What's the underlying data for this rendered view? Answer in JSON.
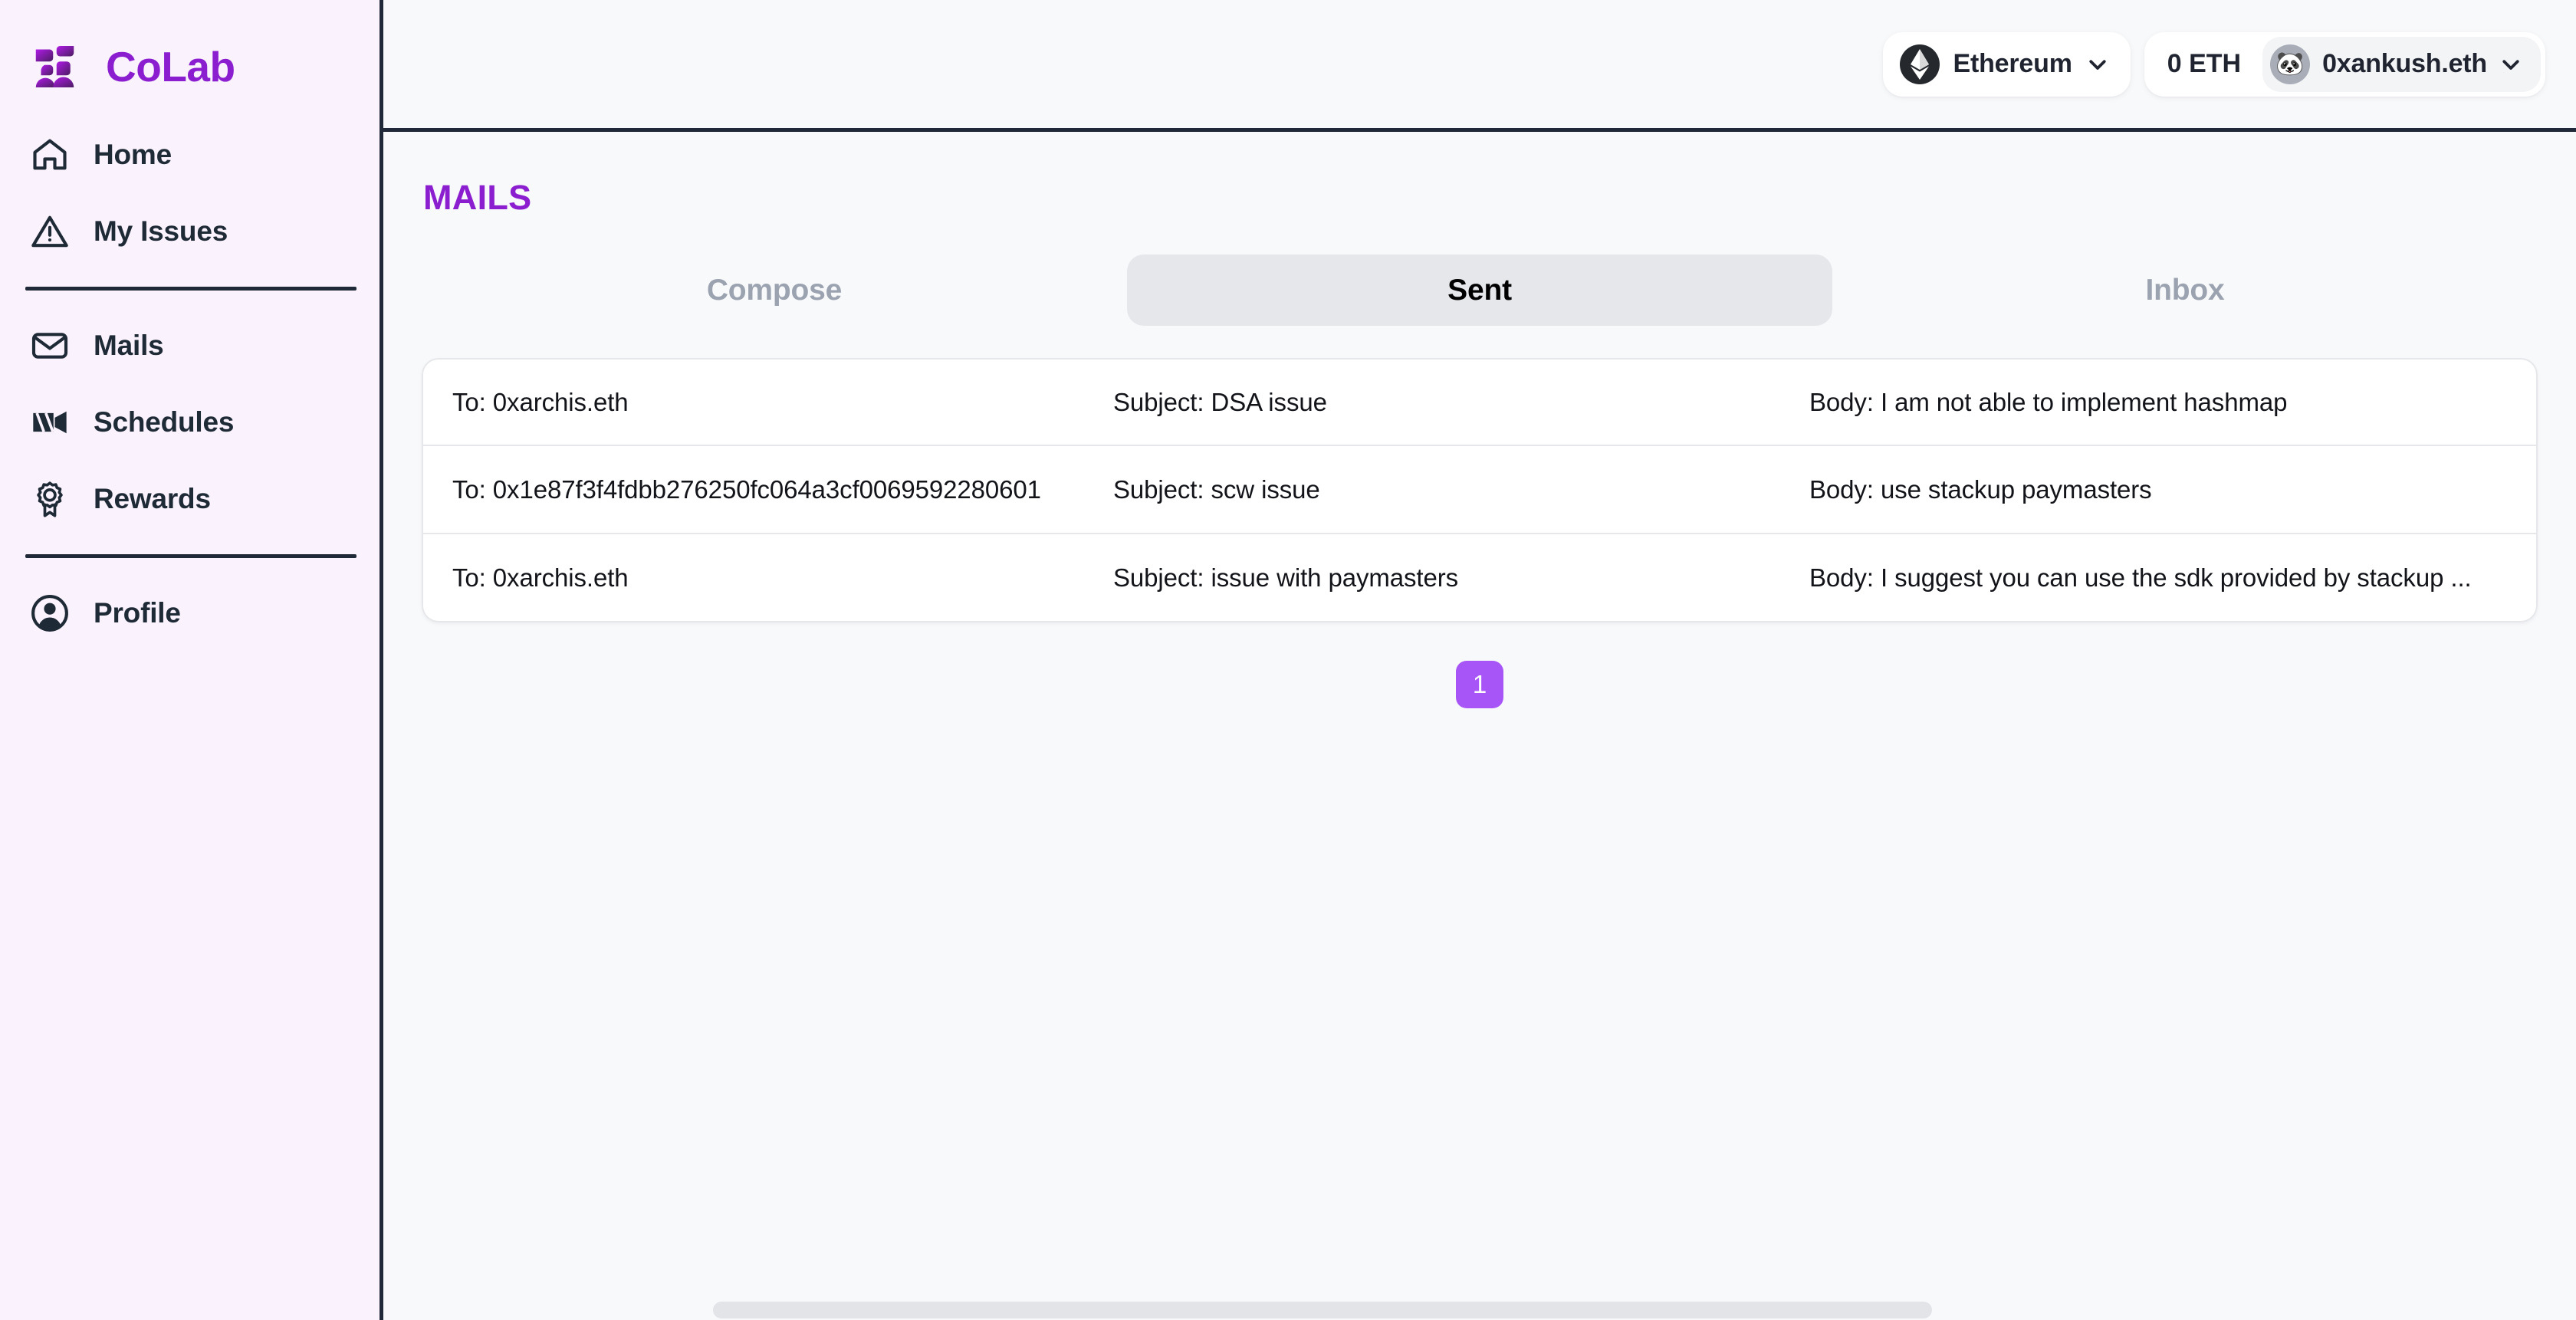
{
  "brand": {
    "name": "CoLab",
    "logo_icon": "colab-logo-icon"
  },
  "sidebar": {
    "groups": [
      {
        "items": [
          {
            "label": "Home",
            "icon": "home-icon"
          },
          {
            "label": "My Issues",
            "icon": "warning-triangle-icon"
          }
        ]
      },
      {
        "items": [
          {
            "label": "Mails",
            "icon": "envelope-icon"
          },
          {
            "label": "Schedules",
            "icon": "video-camera-icon"
          },
          {
            "label": "Rewards",
            "icon": "award-ribbon-icon"
          }
        ]
      },
      {
        "items": [
          {
            "label": "Profile",
            "icon": "user-circle-icon"
          }
        ]
      }
    ]
  },
  "topbar": {
    "network": {
      "label": "Ethereum",
      "icon": "ethereum-icon",
      "caret_icon": "chevron-down-icon"
    },
    "balance": "0 ETH",
    "account": {
      "label": "0xankush.eth",
      "avatar_icon": "panda-avatar-icon",
      "avatar_glyph": "🐼",
      "caret_icon": "chevron-down-icon"
    }
  },
  "page": {
    "title": "MAILS",
    "tabs": [
      {
        "label": "Compose",
        "active": false
      },
      {
        "label": "Sent",
        "active": true
      },
      {
        "label": "Inbox",
        "active": false
      }
    ],
    "mails": [
      {
        "to": "To: 0xarchis.eth",
        "subject": "Subject: DSA issue",
        "body": "Body: I am not able to implement hashmap"
      },
      {
        "to": "To: 0x1e87f3f4fdbb276250fc064a3cf0069592280601",
        "subject": "Subject: scw issue",
        "body": "Body: use stackup paymasters"
      },
      {
        "to": "To: 0xarchis.eth",
        "subject": "Subject: issue with paymasters",
        "body": "Body: I suggest you can use the sdk provided by stackup ..."
      }
    ],
    "pagination": {
      "pages": [
        "1"
      ],
      "current": "1"
    }
  },
  "colors": {
    "brand_purple": "#8b1fd0",
    "accent_purple": "#a855f7",
    "sidebar_bg": "#faf3fe",
    "main_bg": "#f8f9fb",
    "border_dark": "#1f2937",
    "tab_active_bg": "#e5e7eb",
    "muted_text": "#9ca3b0"
  }
}
